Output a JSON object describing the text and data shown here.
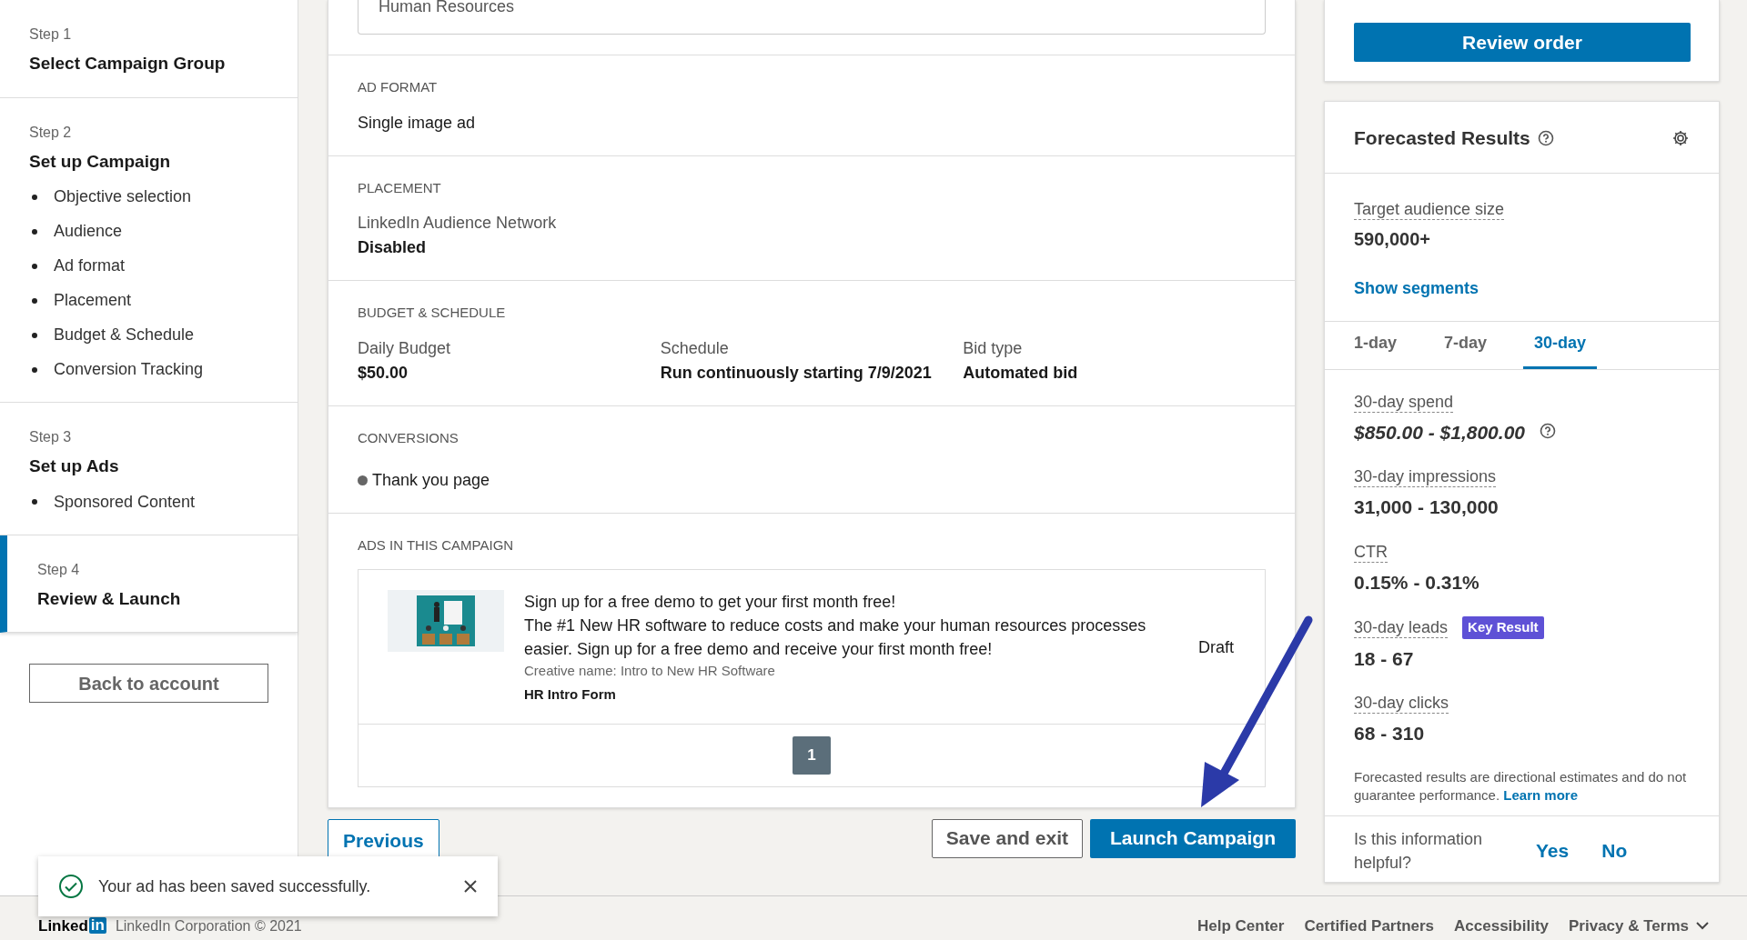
{
  "sidebar": {
    "steps": [
      {
        "step": "Step 1",
        "title": "Select Campaign Group",
        "selected": false
      },
      {
        "step": "Step 2",
        "title": "Set up Campaign",
        "selected": false,
        "items": [
          "Objective selection",
          "Audience",
          "Ad format",
          "Placement",
          "Budget & Schedule",
          "Conversion Tracking"
        ]
      },
      {
        "step": "Step 3",
        "title": "Set up Ads",
        "selected": false,
        "items": [
          "Sponsored Content"
        ]
      },
      {
        "step": "Step 4",
        "title": "Review & Launch",
        "selected": true
      }
    ],
    "back_button": "Back to account"
  },
  "review": {
    "field_value": "Human Resources",
    "sections": [
      {
        "kind": "text",
        "heading": "AD FORMAT",
        "value": "Single image ad"
      },
      {
        "kind": "fields",
        "heading": "PLACEMENT",
        "fields": [
          {
            "label": "LinkedIn Audience Network",
            "value": "Disabled"
          }
        ]
      },
      {
        "kind": "fields",
        "heading": "BUDGET & SCHEDULE",
        "fields": [
          {
            "label": "Daily Budget",
            "value": "$50.00"
          },
          {
            "label": "Schedule",
            "value": "Run continuously starting 7/9/2021"
          },
          {
            "label": "Bid type",
            "value": "Automated bid"
          }
        ]
      },
      {
        "kind": "bullets",
        "heading": "CONVERSIONS",
        "items": [
          "Thank you page"
        ]
      },
      {
        "kind": "ads",
        "heading": "ADS IN THIS CAMPAIGN",
        "ads": [
          {
            "headline": "Sign up for a free demo to get your first month free!",
            "text": "The #1 New HR software to reduce costs and make your human resources processes easier. Sign up for a free demo and receive your first month free!",
            "creative": "Creative name: Intro to New HR Software",
            "form": "HR Intro Form",
            "status": "Draft"
          }
        ],
        "pages": [
          {
            "label": "1",
            "selected": true
          }
        ]
      }
    ]
  },
  "actions": {
    "previous": "Previous",
    "save": "Save and exit",
    "launch": "Launch Campaign"
  },
  "toast": {
    "message": "Your ad has been saved successfully."
  },
  "forecast": {
    "review_button": "Review order",
    "title": "Forecasted Results",
    "audience_label": "Target audience size",
    "audience_value": "590,000+",
    "segments_link": "Show segments",
    "tabs": [
      {
        "label": "1-day",
        "selected": false
      },
      {
        "label": "7-day",
        "selected": false
      },
      {
        "label": "30-day",
        "selected": true
      }
    ],
    "metrics": [
      {
        "label": "30-day spend",
        "value": "$850.00 - $1,800.00",
        "italic": true,
        "help": true
      },
      {
        "label": "30-day impressions",
        "value": "31,000 - 130,000",
        "italic": false,
        "help": false
      },
      {
        "label": "CTR",
        "value": "0.15% - 0.31%",
        "italic": false,
        "help": false
      },
      {
        "label": "30-day leads",
        "value": "18 - 67",
        "italic": false,
        "help": false,
        "badge": "Key Result"
      },
      {
        "label": "30-day clicks",
        "value": "68 - 310",
        "italic": false,
        "help": false
      }
    ],
    "disclaimer": "Forecasted results are directional estimates and do not guarantee performance.",
    "learn_more": "Learn more",
    "feedback": {
      "question": "Is this information helpful?",
      "yes": "Yes",
      "no": "No"
    }
  },
  "footer": {
    "logo_text": "Linked",
    "logo_box": "in",
    "copyright": "LinkedIn Corporation © 2021",
    "links": [
      "Help Center",
      "Certified Partners",
      "Accessibility",
      "Privacy & Terms"
    ]
  }
}
